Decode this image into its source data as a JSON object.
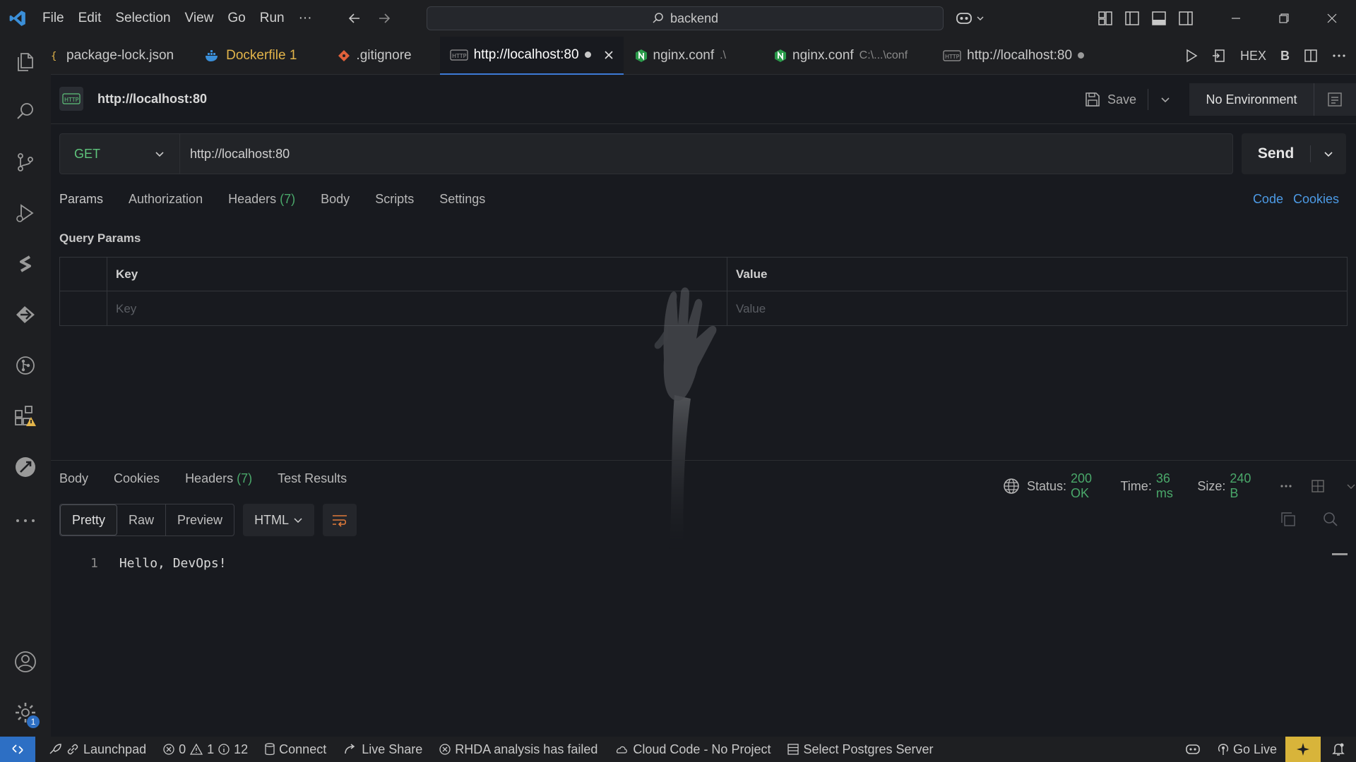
{
  "menu": [
    "File",
    "Edit",
    "Selection",
    "View",
    "Go",
    "Run",
    "···"
  ],
  "search": {
    "text": "backend"
  },
  "tabs": [
    {
      "label": "package-lock.json",
      "suffix": "",
      "color": "#c8c8c8"
    },
    {
      "label": "Dockerfile 1",
      "suffix": "",
      "color": "#e2b44a"
    },
    {
      "label": ".gitignore",
      "suffix": "",
      "color": "#c8c8c8"
    },
    {
      "label": "http://localhost:80",
      "suffix": "",
      "color": "#ffffff"
    },
    {
      "label": "nginx.conf",
      "suffix": ".\\",
      "color": "#c8c8c8"
    },
    {
      "label": "nginx.conf",
      "suffix": "C:\\...\\conf",
      "color": "#c8c8c8"
    },
    {
      "label": "http://localhost:80",
      "suffix": "",
      "color": "#c8c8c8"
    }
  ],
  "tab_actions": {
    "hex": "HEX",
    "bold": "B"
  },
  "request": {
    "badge": "HTTP",
    "title": "http://localhost:80",
    "save_label": "Save",
    "environment": "No Environment",
    "method": "GET",
    "url": "http://localhost:80",
    "send_label": "Send"
  },
  "req_tabs": {
    "params": "Params",
    "authorization": "Authorization",
    "headers": "Headers",
    "headers_count": "(7)",
    "body": "Body",
    "scripts": "Scripts",
    "settings": "Settings",
    "code_link": "Code",
    "cookies_link": "Cookies"
  },
  "query_params": {
    "label": "Query Params",
    "col_key": "Key",
    "col_value": "Value",
    "key_placeholder": "Key",
    "value_placeholder": "Value"
  },
  "response": {
    "tabs": {
      "body": "Body",
      "cookies": "Cookies",
      "headers": "Headers",
      "headers_count": "(7)",
      "tests": "Test Results"
    },
    "status_label": "Status:",
    "status_value": "200 OK",
    "time_label": "Time:",
    "time_value": "36 ms",
    "size_label": "Size:",
    "size_value": "240 B",
    "formats": [
      "Pretty",
      "Raw",
      "Preview"
    ],
    "language": "HTML",
    "line_number": "1",
    "line_text": "Hello, DevOps!"
  },
  "activity": {
    "settings_badge": "1"
  },
  "statusbar": {
    "launchpad": "Launchpad",
    "errors": "0",
    "warnings": "1",
    "infos": "12",
    "connect": "Connect",
    "live_share": "Live Share",
    "rhda": "RHDA analysis has failed",
    "cloud_code": "Cloud Code - No Project",
    "postgres": "Select Postgres Server",
    "go_live": "Go Live"
  },
  "colors": {
    "accent": "#3d7ad6",
    "success": "#4aa86a",
    "link": "#4d9be6",
    "method": "#5fc47c"
  }
}
